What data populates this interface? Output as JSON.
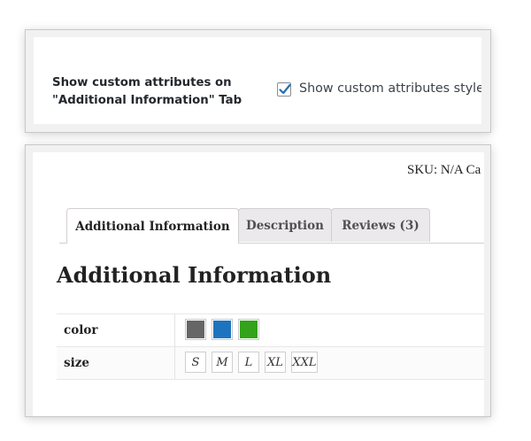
{
  "settings": {
    "label": "Show custom attributes on \"Additional Information\" Tab",
    "checkbox_checked": true,
    "checkbox_text": "Show custom attributes style o"
  },
  "product": {
    "sku_text": "SKU: N/A Ca",
    "tabs": [
      {
        "label": "Additional Information",
        "active": true
      },
      {
        "label": "Description",
        "active": false
      },
      {
        "label": "Reviews (3)",
        "active": false
      }
    ],
    "heading": "Additional Information",
    "attributes": [
      {
        "name": "color",
        "swatches": [
          "#666666",
          "#1e73be",
          "#32a31a"
        ]
      },
      {
        "name": "size",
        "options": [
          "S",
          "M",
          "L",
          "XL",
          "XXL"
        ]
      }
    ]
  },
  "colors": {
    "checkmark": "#2271b1"
  }
}
